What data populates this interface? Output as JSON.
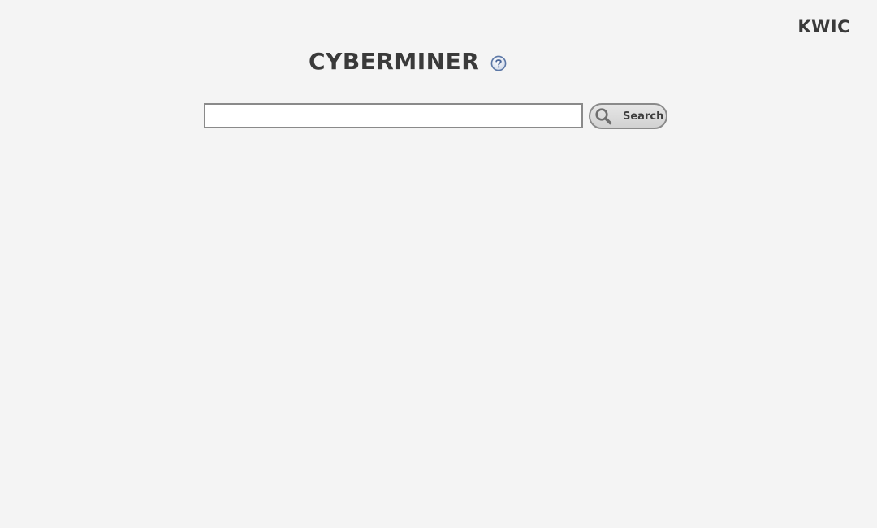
{
  "header": {
    "kwic_link": "KWIC"
  },
  "main": {
    "title": "CYBERMINER",
    "help_icon": "question-circle-icon",
    "search": {
      "value": "",
      "placeholder": "",
      "button_label": "Search",
      "button_icon": "magnifier-icon"
    }
  },
  "colors": {
    "background": "#f4f4f4",
    "text": "#3a3a3a",
    "help_icon_blue": "#5b77a6",
    "border_gray": "#8a8a8a"
  }
}
